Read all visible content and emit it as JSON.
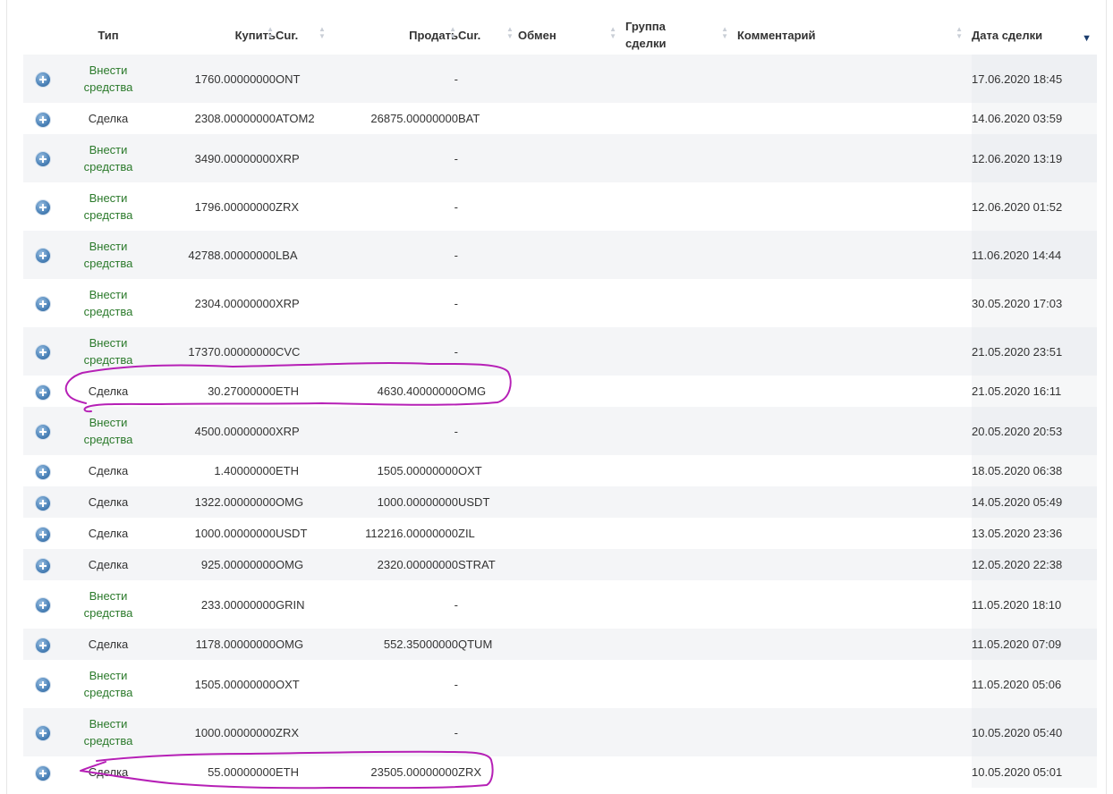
{
  "table": {
    "columns": {
      "type": "Тип",
      "buy": "Купить",
      "buy_currency": "Cur.",
      "sell": "Продать",
      "sell_currency": "Cur.",
      "exchange": "Обмен",
      "group_line1": "Группа",
      "group_line2": "сделки",
      "comment": "Комментарий",
      "date": "Дата сделки"
    },
    "sort_active_icon": "sort-desc-icon",
    "rows": [
      {
        "type_line1": "Внести",
        "type_line2": "средства",
        "buy": "1760.00000000",
        "buy_cur": "ONT",
        "sell": "-",
        "sell_cur": "",
        "date": "17.06.2020 18:45"
      },
      {
        "type_line1": "Сделка",
        "type_line2": "",
        "buy": "2308.00000000",
        "buy_cur": "ATOM2",
        "sell": "26875.00000000",
        "sell_cur": "BAT",
        "date": "14.06.2020 03:59"
      },
      {
        "type_line1": "Внести",
        "type_line2": "средства",
        "buy": "3490.00000000",
        "buy_cur": "XRP",
        "sell": "-",
        "sell_cur": "",
        "date": "12.06.2020 13:19"
      },
      {
        "type_line1": "Внести",
        "type_line2": "средства",
        "buy": "1796.00000000",
        "buy_cur": "ZRX",
        "sell": "-",
        "sell_cur": "",
        "date": "12.06.2020 01:52"
      },
      {
        "type_line1": "Внести",
        "type_line2": "средства",
        "buy": "42788.00000000",
        "buy_cur": "LBA",
        "sell": "-",
        "sell_cur": "",
        "date": "11.06.2020 14:44"
      },
      {
        "type_line1": "Внести",
        "type_line2": "средства",
        "buy": "2304.00000000",
        "buy_cur": "XRP",
        "sell": "-",
        "sell_cur": "",
        "date": "30.05.2020 17:03"
      },
      {
        "type_line1": "Внести",
        "type_line2": "средства",
        "buy": "17370.00000000",
        "buy_cur": "CVC",
        "sell": "-",
        "sell_cur": "",
        "date": "21.05.2020 23:51"
      },
      {
        "type_line1": "Сделка",
        "type_line2": "",
        "buy": "30.27000000",
        "buy_cur": "ETH",
        "sell": "4630.40000000",
        "sell_cur": "OMG",
        "date": "21.05.2020 16:11"
      },
      {
        "type_line1": "Внести",
        "type_line2": "средства",
        "buy": "4500.00000000",
        "buy_cur": "XRP",
        "sell": "-",
        "sell_cur": "",
        "date": "20.05.2020 20:53"
      },
      {
        "type_line1": "Сделка",
        "type_line2": "",
        "buy": "1.40000000",
        "buy_cur": "ETH",
        "sell": "1505.00000000",
        "sell_cur": "OXT",
        "date": "18.05.2020 06:38"
      },
      {
        "type_line1": "Сделка",
        "type_line2": "",
        "buy": "1322.00000000",
        "buy_cur": "OMG",
        "sell": "1000.00000000",
        "sell_cur": "USDT",
        "date": "14.05.2020 05:49"
      },
      {
        "type_line1": "Сделка",
        "type_line2": "",
        "buy": "1000.00000000",
        "buy_cur": "USDT",
        "sell": "112216.00000000",
        "sell_cur": "ZIL",
        "date": "13.05.2020 23:36"
      },
      {
        "type_line1": "Сделка",
        "type_line2": "",
        "buy": "925.00000000",
        "buy_cur": "OMG",
        "sell": "2320.00000000",
        "sell_cur": "STRAT",
        "date": "12.05.2020 22:38"
      },
      {
        "type_line1": "Внести",
        "type_line2": "средства",
        "buy": "233.00000000",
        "buy_cur": "GRIN",
        "sell": "-",
        "sell_cur": "",
        "date": "11.05.2020 18:10"
      },
      {
        "type_line1": "Сделка",
        "type_line2": "",
        "buy": "1178.00000000",
        "buy_cur": "OMG",
        "sell": "552.35000000",
        "sell_cur": "QTUM",
        "date": "11.05.2020 07:09"
      },
      {
        "type_line1": "Внести",
        "type_line2": "средства",
        "buy": "1505.00000000",
        "buy_cur": "OXT",
        "sell": "-",
        "sell_cur": "",
        "date": "11.05.2020 05:06"
      },
      {
        "type_line1": "Внести",
        "type_line2": "средства",
        "buy": "1000.00000000",
        "buy_cur": "ZRX",
        "sell": "-",
        "sell_cur": "",
        "date": "10.05.2020 05:40"
      },
      {
        "type_line1": "Сделка",
        "type_line2": "",
        "buy": "55.00000000",
        "buy_cur": "ETH",
        "sell": "23505.00000000",
        "sell_cur": "ZRX",
        "date": "10.05.2020 05:01"
      }
    ]
  },
  "colors": {
    "deposit_text": "#2b7a2b",
    "row_stripe": "#f4f5f7",
    "date_column": "#eef0f3",
    "annotation": "#b620b6",
    "expand_icon": "#4b82b8"
  },
  "annotations": [
    {
      "name": "highlight-row-8",
      "shape": "hand-drawn-loop"
    },
    {
      "name": "highlight-row-18",
      "shape": "hand-drawn-loop"
    }
  ]
}
